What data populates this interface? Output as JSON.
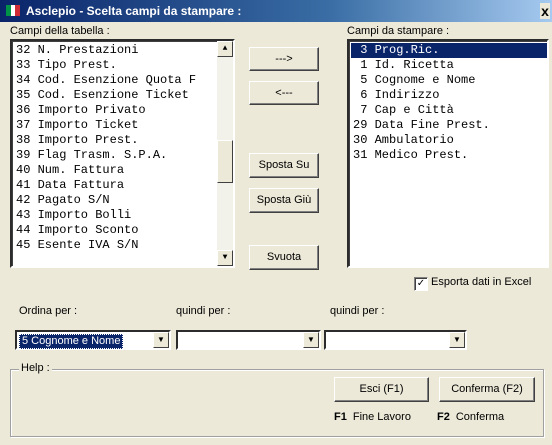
{
  "window": {
    "title": "Asclepio - Scelta campi da stampare :",
    "close_label": "x"
  },
  "left_list": {
    "label": "Campi della tabella :",
    "items": [
      "32 N. Prestazioni",
      "33 Tipo Prest.",
      "34 Cod. Esenzione Quota F",
      "35 Cod. Esenzione Ticket",
      "36 Importo Privato",
      "37 Importo Ticket",
      "38 Importo Prest.",
      "39 Flag Trasm. S.P.A.",
      "40 Num. Fattura",
      "41 Data Fattura",
      "42 Pagato S/N",
      "43 Importo Bolli",
      "44 Importo Sconto",
      "45 Esente IVA S/N"
    ]
  },
  "right_list": {
    "label": "Campi da stampare :",
    "items": [
      " 3 Prog.Ric.",
      " 1 Id. Ricetta",
      " 5 Cognome e Nome",
      " 6 Indirizzo",
      " 7 Cap e Città",
      "29 Data Fine Prest.",
      "30 Ambulatorio",
      "31 Medico Prest."
    ],
    "selected_index": 0
  },
  "buttons": {
    "add": "--->",
    "remove": "<---",
    "move_up": "Sposta Su",
    "move_down": "Sposta Giù",
    "clear": "Svuota",
    "exit": "Esci (F1)",
    "confirm": "Conferma (F2)"
  },
  "export": {
    "label": "Esporta dati in Excel",
    "checked": true,
    "check_mark": "✓"
  },
  "sort": {
    "label1": "Ordina per :",
    "label2": "quindi per :",
    "label3": "quindi per :",
    "value1": "5 Cognome e Nome",
    "value2": "",
    "value3": ""
  },
  "help": {
    "legend": "Help :",
    "f1_key": "F1",
    "f1_text": "Fine Lavoro",
    "f2_key": "F2",
    "f2_text": "Conferma"
  },
  "colors": {
    "selection": "#0a246a",
    "face": "#ece9d8"
  }
}
